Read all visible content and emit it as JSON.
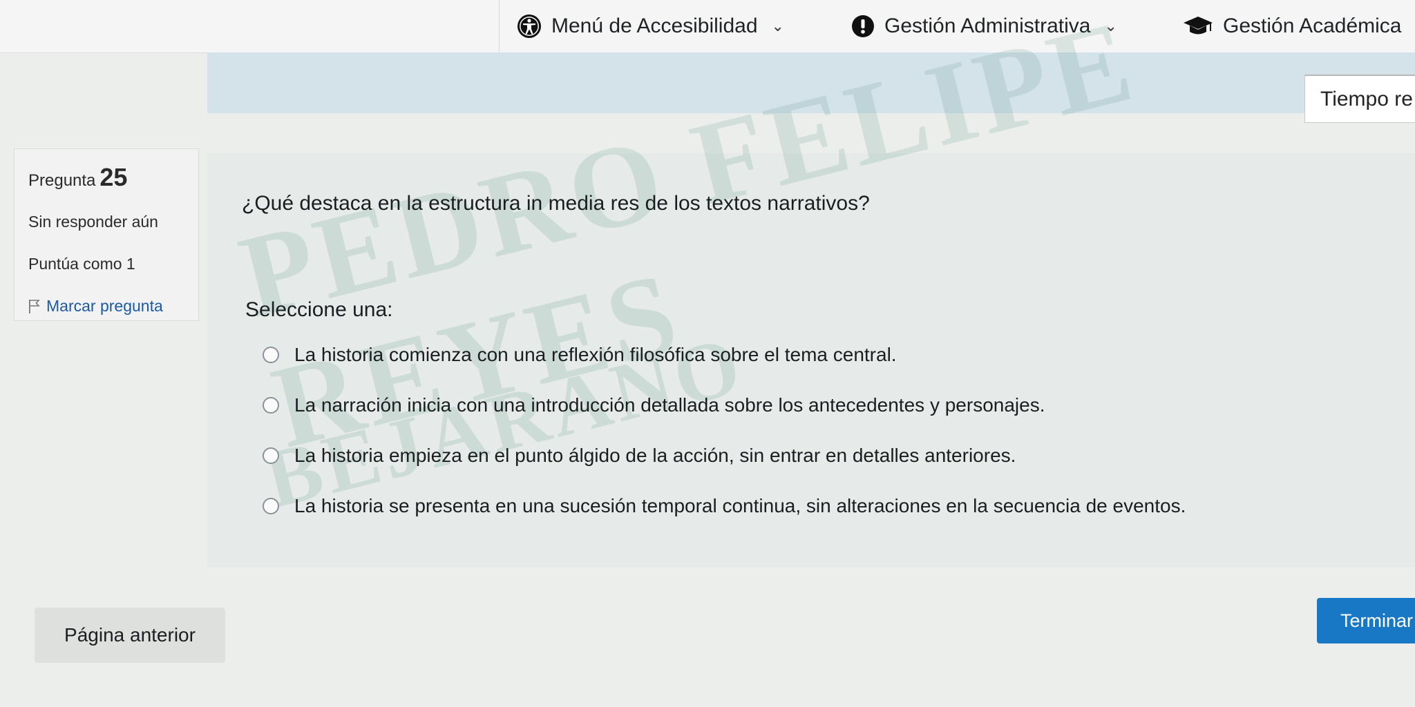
{
  "topbar": {
    "accessibility_label": "Menú de Accesibilidad",
    "admin_label": "Gestión Administrativa",
    "academic_label": "Gestión Académica"
  },
  "timer": {
    "label": "Tiempo re"
  },
  "question_info": {
    "number_prefix": "Pregunta",
    "number": "25",
    "state": "Sin responder aún",
    "grade": "Puntúa como 1",
    "flag_label": "Marcar pregunta"
  },
  "question": {
    "text": "¿Qué destaca en la estructura in media res de los textos narrativos?",
    "prompt": "Seleccione una:",
    "options": [
      "La historia comienza con una reflexión filosófica sobre el tema central.",
      "La narración inicia con una introducción detallada sobre los antecedentes y personajes.",
      "La historia empieza en el punto álgido de la acción, sin entrar en detalles anteriores.",
      "La historia se presenta en una sucesión temporal continua, sin alteraciones en la secuencia de eventos."
    ]
  },
  "watermark": {
    "line1": "PEDRO FELIPE REYES",
    "line2": "BEJARANO",
    "mark": "U"
  },
  "footer": {
    "prev_label": "Página anterior",
    "finish_label": "Terminar"
  },
  "colors": {
    "accent": "#1978c6",
    "strip": "#d4e2ea",
    "watermark": "#2f7a6a"
  }
}
